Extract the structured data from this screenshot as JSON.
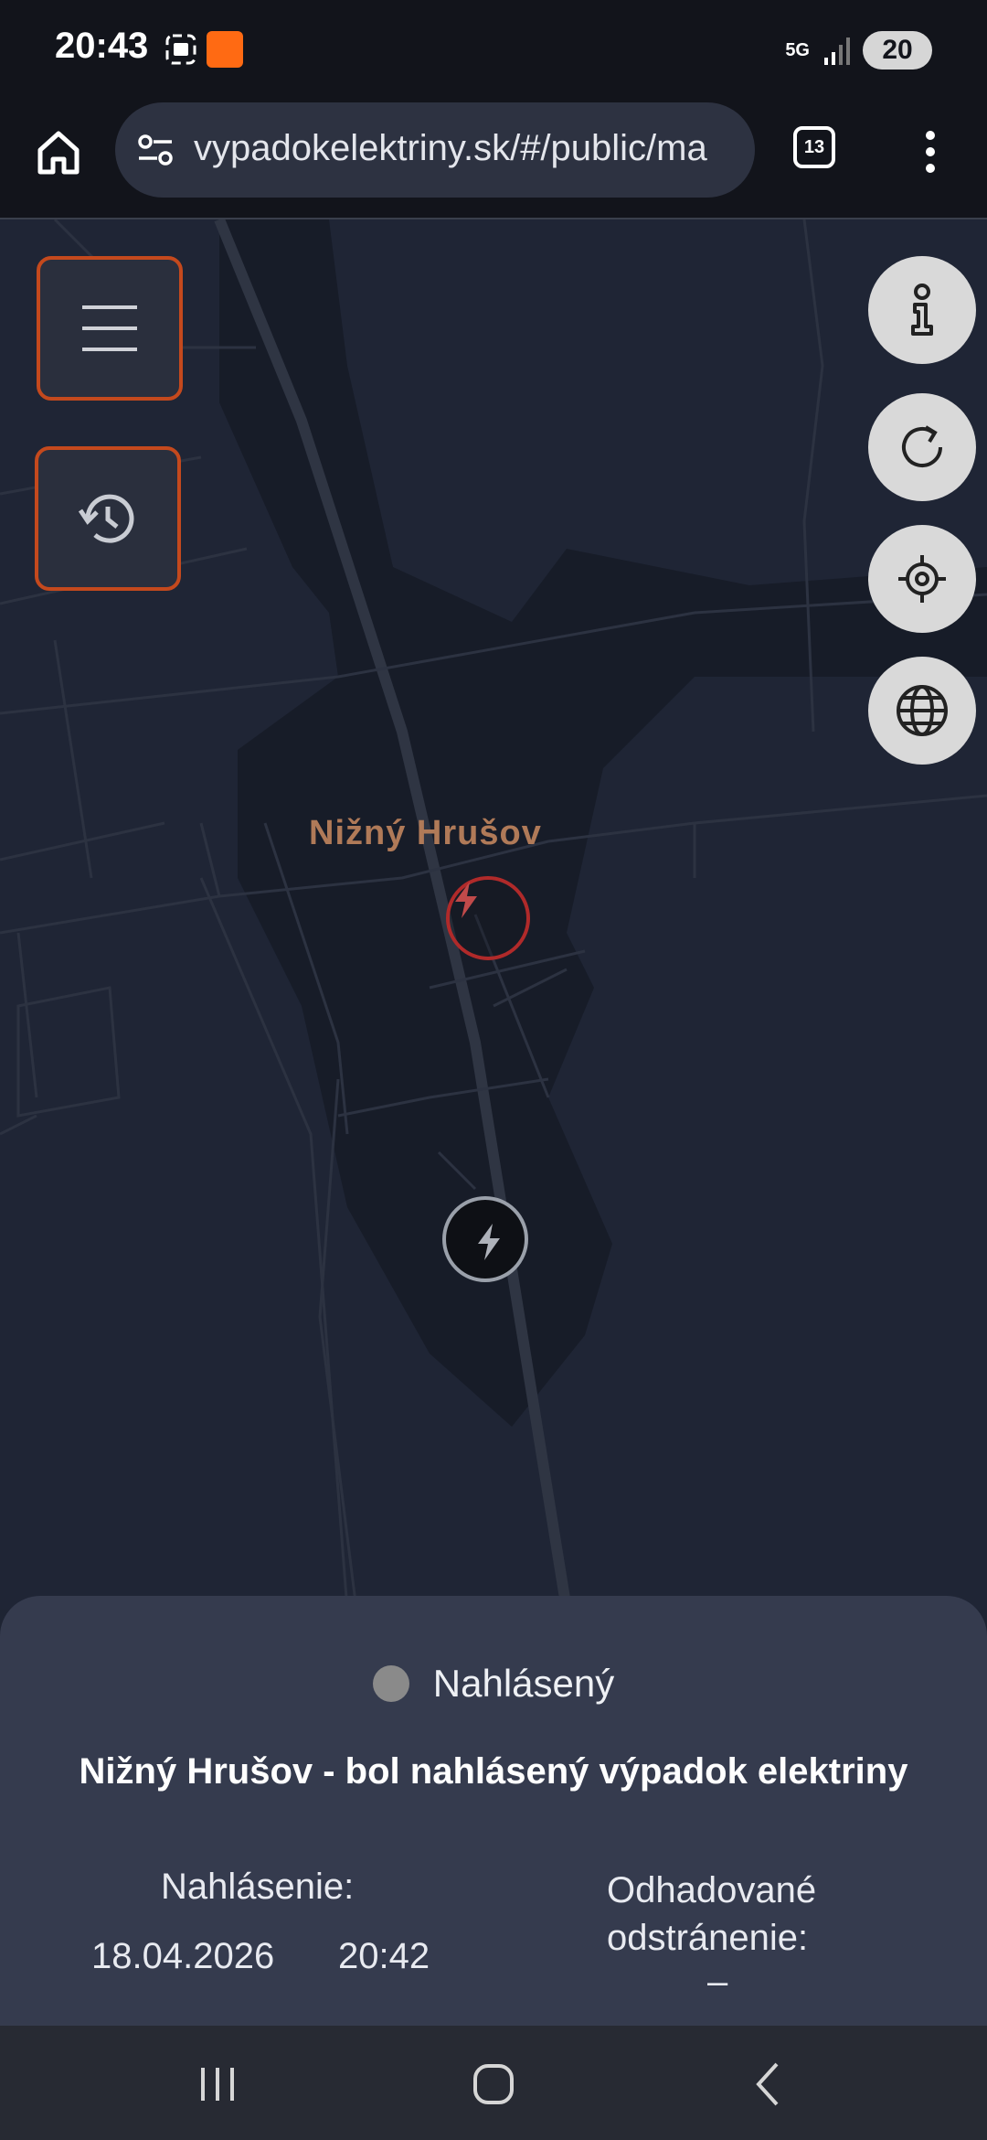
{
  "status_bar": {
    "time": "20:43",
    "network": "5G",
    "battery": "20",
    "icons": [
      "screenshot-icon",
      "temu-app-icon",
      "signal-icon"
    ]
  },
  "browser": {
    "url": "vypadokelektriny.sk/#/public/ma",
    "tab_count": "13",
    "icons": [
      "home-icon",
      "site-settings-icon",
      "more-vert-icon"
    ]
  },
  "map": {
    "place_label": "Nižný Hrušov",
    "markers": [
      {
        "type": "outage-reported",
        "color": "#b02a2a"
      },
      {
        "type": "outage-other",
        "color": "#9aa0aa"
      }
    ],
    "buttons": [
      "menu-icon",
      "history-icon",
      "info-icon",
      "refresh-icon",
      "locate-icon",
      "globe-icon"
    ],
    "accent_color": "#c4491d"
  },
  "sheet": {
    "status_label": "Nahlásený",
    "status_color": "#8a8a8a",
    "title": "Nižný Hrušov - bol nahlásený výpadok elektriny",
    "report_label": "Nahlásenie:",
    "report_date": "18.04.2026",
    "report_time": "20:42",
    "estimate_label": "Odhadované odstránenie:",
    "estimate_value": "–"
  },
  "nav_bar": {
    "icons": [
      "recent-apps-icon",
      "home-circle-icon",
      "back-icon"
    ]
  }
}
